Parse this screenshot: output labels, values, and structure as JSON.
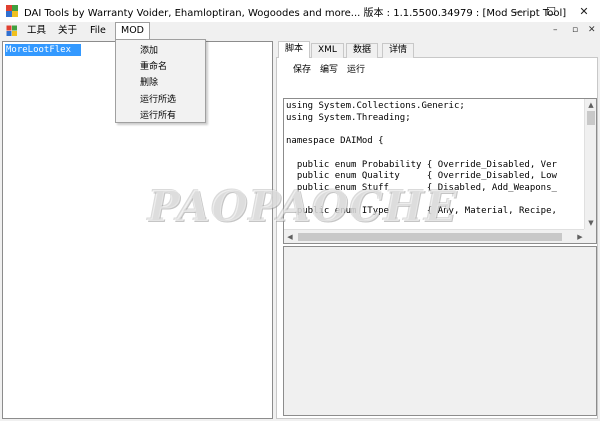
{
  "window": {
    "title": "DAI Tools by Warranty Voider, Ehamloptiran, Wogoodes and more... 版本 : 1.1.5500.34979 : [Mod Script Tool]",
    "minimize_glyph": "—",
    "maximize_glyph": "☐",
    "close_glyph": "✕"
  },
  "menubar": {
    "items": [
      "工具",
      "关于",
      "File",
      "MOD"
    ],
    "active": "MOD",
    "mdi_controls": [
      "–",
      "▫",
      "✕"
    ]
  },
  "mod_menu": {
    "items": [
      "添加",
      "重命名",
      "删除",
      "运行所选",
      "运行所有"
    ]
  },
  "mod_list": {
    "items": [
      "MoreLootFlex"
    ],
    "selected": "MoreLootFlex"
  },
  "tabs": {
    "items": [
      "脚本",
      "XML",
      "数据",
      "详情"
    ],
    "active": "脚本"
  },
  "script_toolbar": {
    "buttons": [
      "保存",
      "编写",
      "运行"
    ]
  },
  "editor": {
    "lines": [
      "using System.Collections.Generic;",
      "using System.Threading;",
      "",
      "namespace DAIMod {",
      "",
      "  public enum Probability { Override_Disabled, Ver",
      "  public enum Quality     { Override_Disabled, Low",
      "  public enum Stuff       { Disabled, Add_Weapons_",
      "",
      "  public enum IType       { Any, Material, Recipe,"
    ]
  },
  "watermark": "PAOPAOCHE",
  "colors": {
    "selection": "#3399ff",
    "panel_bg": "#f0f0f0",
    "editor_bg": "#ffffff"
  },
  "icons": [
    "app-icon",
    "mdi-child-icon",
    "scroll-up-arrow",
    "scroll-down-arrow",
    "scroll-left-arrow",
    "scroll-right-arrow"
  ]
}
